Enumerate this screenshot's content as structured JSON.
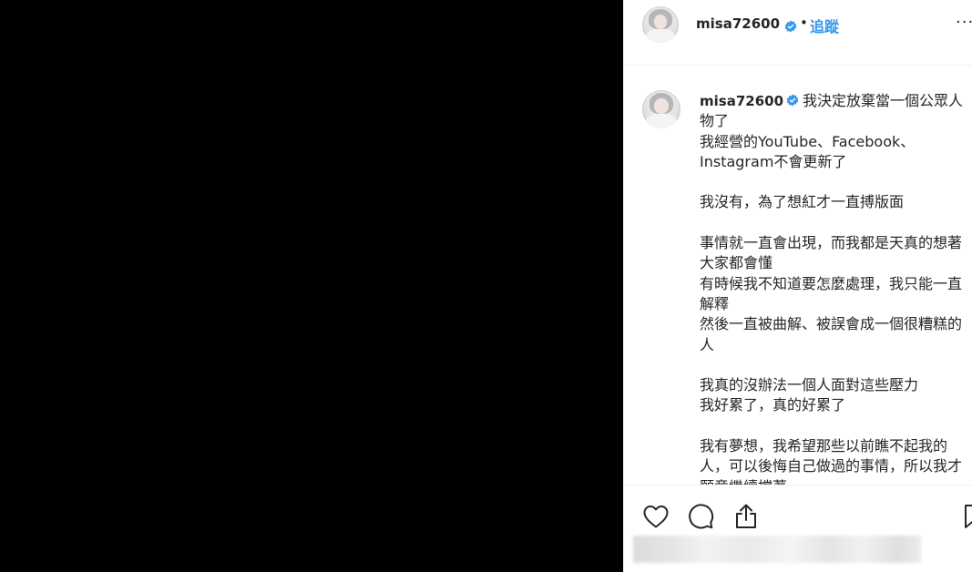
{
  "header": {
    "username": "misa72600",
    "separator": "•",
    "follow_label": "追蹤",
    "more_label": "···"
  },
  "caption": {
    "username": "misa72600",
    "lines": [
      "我決定放棄當一個公眾人物了",
      "我經營的YouTube、Facebook、Instagram不會更新了",
      "",
      "我沒有，為了想紅才一直搏版面",
      "",
      "事情就一直會出現，而我都是天真的想著大家都會懂",
      "有時候我不知道要怎麼處理，我只能一直解釋",
      "然後一直被曲解、被誤會成一個很糟糕的人",
      "",
      "我真的沒辦法一個人面對這些壓力",
      "我好累了，真的好累了",
      "",
      "我有夢想，我希望那些以前瞧不起我的人，可以後悔自己做過的事情，所以我才願意繼續撐著"
    ]
  },
  "icons": {
    "verified": "verified-badge-icon",
    "like": "heart-icon",
    "comment": "comment-icon",
    "share": "share-icon",
    "save": "bookmark-icon"
  },
  "colors": {
    "accent": "#3897f0",
    "text": "#262626",
    "border": "#efefef",
    "media_background": "#000000"
  }
}
